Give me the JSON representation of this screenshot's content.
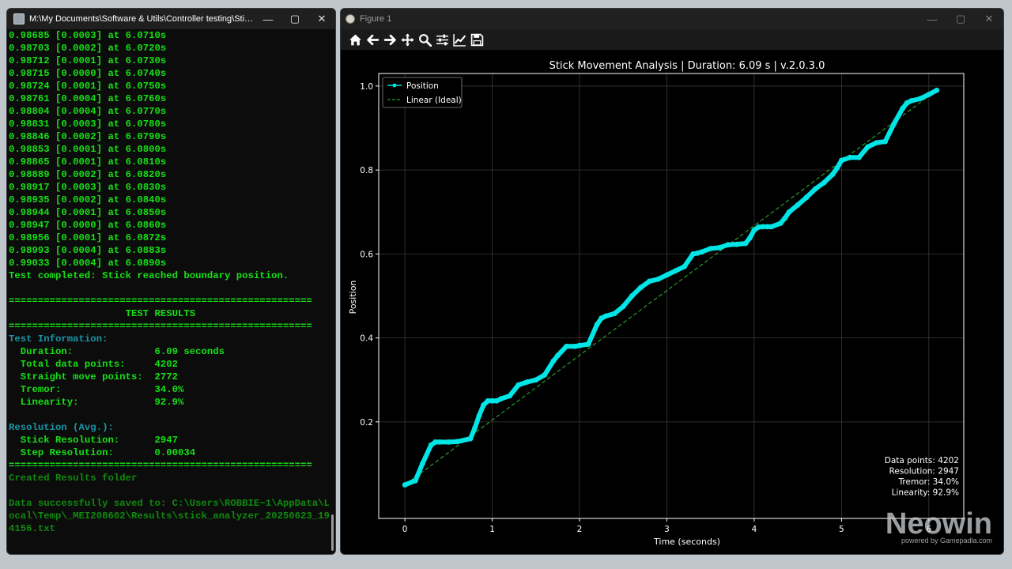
{
  "console": {
    "title": "M:\\My Documents\\Software & Utils\\Controller testing\\StickAnalyzer\\Stic...",
    "lines": [
      {
        "text": "0.98685 [0.0003] at 6.0710s",
        "color": "#16e016"
      },
      {
        "text": "0.98703 [0.0002] at 6.0720s",
        "color": "#16e016"
      },
      {
        "text": "0.98712 [0.0001] at 6.0730s",
        "color": "#16e016"
      },
      {
        "text": "0.98715 [0.0000] at 6.0740s",
        "color": "#16e016"
      },
      {
        "text": "0.98724 [0.0001] at 6.0750s",
        "color": "#16e016"
      },
      {
        "text": "0.98761 [0.0004] at 6.0760s",
        "color": "#16e016"
      },
      {
        "text": "0.98804 [0.0004] at 6.0770s",
        "color": "#16e016"
      },
      {
        "text": "0.98831 [0.0003] at 6.0780s",
        "color": "#16e016"
      },
      {
        "text": "0.98846 [0.0002] at 6.0790s",
        "color": "#16e016"
      },
      {
        "text": "0.98853 [0.0001] at 6.0800s",
        "color": "#16e016"
      },
      {
        "text": "0.98865 [0.0001] at 6.0810s",
        "color": "#16e016"
      },
      {
        "text": "0.98889 [0.0002] at 6.0820s",
        "color": "#16e016"
      },
      {
        "text": "0.98917 [0.0003] at 6.0830s",
        "color": "#16e016"
      },
      {
        "text": "0.98935 [0.0002] at 6.0840s",
        "color": "#16e016"
      },
      {
        "text": "0.98944 [0.0001] at 6.0850s",
        "color": "#16e016"
      },
      {
        "text": "0.98947 [0.0000] at 6.0860s",
        "color": "#16e016"
      },
      {
        "text": "0.98956 [0.0001] at 6.0872s",
        "color": "#16e016"
      },
      {
        "text": "0.98993 [0.0004] at 6.0883s",
        "color": "#16e016"
      },
      {
        "text": "0.99033 [0.0004] at 6.0890s",
        "color": "#16e016"
      },
      {
        "text": "Test completed: Stick reached boundary position.",
        "color": "#16e016"
      },
      {
        "text": "",
        "color": "#16e016"
      },
      {
        "text": "====================================================",
        "color": "#16e016"
      },
      {
        "text": "                    TEST RESULTS",
        "color": "#16e016"
      },
      {
        "text": "====================================================",
        "color": "#16e016"
      },
      {
        "text": "Test Information:",
        "color": "#1a95a6"
      },
      {
        "text": "  Duration:              6.09 seconds",
        "color": "#16e016"
      },
      {
        "text": "  Total data points:     4202",
        "color": "#16e016"
      },
      {
        "text": "  Straight move points:  2772",
        "color": "#16e016"
      },
      {
        "text": "  Tremor:                34.0%",
        "color": "#16e016"
      },
      {
        "text": "  Linearity:             92.9%",
        "color": "#16e016"
      },
      {
        "text": "",
        "color": "#16e016"
      },
      {
        "text": "Resolution (Avg.):",
        "color": "#1a95a6"
      },
      {
        "text": "  Stick Resolution:      2947",
        "color": "#16e016"
      },
      {
        "text": "  Step Resolution:       0.00034",
        "color": "#16e016"
      },
      {
        "text": "====================================================",
        "color": "#16e016"
      },
      {
        "text": "Created Results folder",
        "color": "#0e8a0e"
      },
      {
        "text": "",
        "color": "#16e016"
      },
      {
        "text": "Data successfully saved to: C:\\Users\\ROBBIE~1\\AppData\\L",
        "color": "#0e8a0e"
      },
      {
        "text": "ocal\\Temp\\_MEI208602\\Results\\stick_analyzer_20250623_19",
        "color": "#0e8a0e"
      },
      {
        "text": "4156.txt",
        "color": "#0e8a0e"
      }
    ]
  },
  "figure": {
    "title": "Figure 1",
    "toolbar": [
      {
        "name": "home-icon"
      },
      {
        "name": "back-arrow-icon"
      },
      {
        "name": "forward-arrow-icon"
      },
      {
        "name": "pan-move-icon"
      },
      {
        "name": "zoom-magnifier-icon"
      },
      {
        "name": "configure-subplots-icon"
      },
      {
        "name": "edit-axis-icon"
      },
      {
        "name": "save-floppy-icon"
      }
    ]
  },
  "chart_data": {
    "type": "line",
    "title": "Stick Movement Analysis | Duration: 6.09 s | v.2.0.3.0",
    "xlabel": "Time (seconds)",
    "ylabel": "Position",
    "xlim": [
      -0.3,
      6.4
    ],
    "ylim": [
      -0.03,
      1.03
    ],
    "xticks": [
      0,
      1,
      2,
      3,
      4,
      5,
      6
    ],
    "yticks": [
      0.2,
      0.4,
      0.6,
      0.8,
      1.0
    ],
    "xtick_labels": [
      "0",
      "1",
      "2",
      "3",
      "4",
      "5",
      "6"
    ],
    "ytick_labels": [
      "0.2",
      "0.4",
      "0.6",
      "0.8",
      "1.0"
    ],
    "grid": true,
    "legend_position": "top-left",
    "background": "#000000",
    "series": [
      {
        "name": "Position",
        "color": "#00e5e5",
        "style": "line-with-markers",
        "x": [
          0.0,
          0.12,
          0.2,
          0.3,
          0.35,
          0.4,
          0.5,
          0.6,
          0.75,
          0.8,
          0.85,
          0.9,
          0.95,
          1.0,
          1.05,
          1.1,
          1.2,
          1.3,
          1.4,
          1.5,
          1.6,
          1.7,
          1.75,
          1.85,
          1.95,
          2.0,
          2.1,
          2.2,
          2.25,
          2.3,
          2.4,
          2.5,
          2.6,
          2.7,
          2.8,
          2.9,
          3.0,
          3.1,
          3.2,
          3.3,
          3.35,
          3.4,
          3.5,
          3.6,
          3.7,
          3.8,
          3.9,
          3.95,
          4.0,
          4.05,
          4.1,
          4.15,
          4.2,
          4.3,
          4.35,
          4.4,
          4.5,
          4.6,
          4.7,
          4.8,
          4.9,
          4.95,
          5.0,
          5.1,
          5.2,
          5.3,
          5.4,
          5.5,
          5.6,
          5.7,
          5.75,
          5.8,
          5.9,
          6.0,
          6.09
        ],
        "y": [
          0.05,
          0.06,
          0.1,
          0.145,
          0.152,
          0.152,
          0.152,
          0.153,
          0.16,
          0.185,
          0.215,
          0.24,
          0.25,
          0.25,
          0.25,
          0.255,
          0.262,
          0.288,
          0.295,
          0.3,
          0.312,
          0.345,
          0.358,
          0.38,
          0.38,
          0.382,
          0.385,
          0.432,
          0.447,
          0.452,
          0.458,
          0.475,
          0.5,
          0.52,
          0.535,
          0.54,
          0.55,
          0.56,
          0.57,
          0.6,
          0.602,
          0.605,
          0.613,
          0.615,
          0.622,
          0.623,
          0.625,
          0.638,
          0.657,
          0.664,
          0.665,
          0.665,
          0.665,
          0.673,
          0.685,
          0.7,
          0.717,
          0.735,
          0.755,
          0.77,
          0.79,
          0.805,
          0.823,
          0.83,
          0.83,
          0.855,
          0.865,
          0.868,
          0.91,
          0.947,
          0.96,
          0.965,
          0.97,
          0.98,
          0.99
        ]
      },
      {
        "name": "Linear (Ideal)",
        "color": "#2a9d2a",
        "style": "dashed",
        "x": [
          0.0,
          6.09
        ],
        "y": [
          0.05,
          0.99
        ]
      }
    ],
    "annotation": [
      "Data points: 4202",
      "Resolution: 2947",
      "Tremor: 34.0%",
      "Linearity: 92.9%"
    ]
  },
  "watermark": {
    "brand": "Neowin",
    "tagline": "powered by Gamepadla.com"
  }
}
